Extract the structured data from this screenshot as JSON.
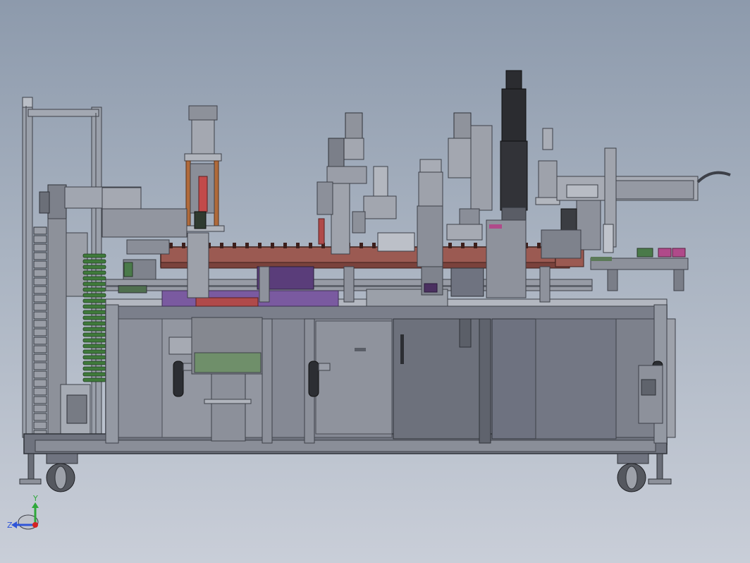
{
  "view": {
    "title": "",
    "background_top": "#8d9aac",
    "background_bottom": "#c9ced8"
  },
  "triad": {
    "y_label": "Y",
    "z_label": "Z",
    "y_color": "#2fa83a",
    "z_color": "#2f55d8",
    "x_color": "#d42222"
  },
  "colors": {
    "steel": "#8e929b",
    "steel_dark": "#5c6069",
    "panel": "#6f7380",
    "rail_red": "#9b5a52",
    "copper": "#b06a3a",
    "motor_black": "#2b2c30",
    "spring_green": "#3f7a3a",
    "purple": "#5a3d7a",
    "magenta": "#b04a8a"
  }
}
